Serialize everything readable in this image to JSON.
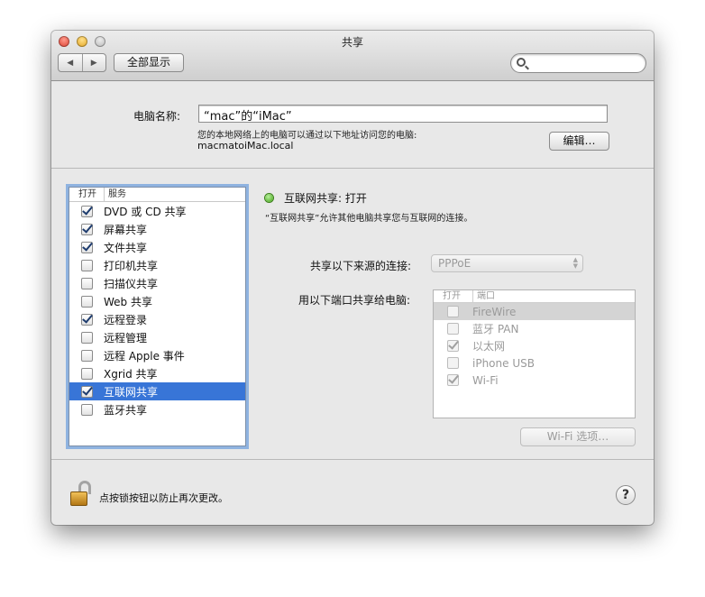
{
  "window": {
    "title": "共享"
  },
  "toolbar": {
    "back_glyph": "◀",
    "forward_glyph": "▶",
    "show_all_label": "全部显示",
    "search_value": ""
  },
  "computer_name": {
    "label": "电脑名称:",
    "value": "“mac”的“iMac”",
    "address_description": "您的本地网络上的电脑可以通过以下地址访问您的电脑:",
    "address": "macmatoiMac.local",
    "edit_label": "编辑…"
  },
  "services": {
    "header_on": "打开",
    "header_service": "服务",
    "items": [
      {
        "label": "DVD 或 CD 共享",
        "checked": true,
        "selected": false
      },
      {
        "label": "屏幕共享",
        "checked": true,
        "selected": false
      },
      {
        "label": "文件共享",
        "checked": true,
        "selected": false
      },
      {
        "label": "打印机共享",
        "checked": false,
        "selected": false
      },
      {
        "label": "扫描仪共享",
        "checked": false,
        "selected": false
      },
      {
        "label": "Web 共享",
        "checked": false,
        "selected": false
      },
      {
        "label": "远程登录",
        "checked": true,
        "selected": false
      },
      {
        "label": "远程管理",
        "checked": false,
        "selected": false
      },
      {
        "label": "远程 Apple 事件",
        "checked": false,
        "selected": false
      },
      {
        "label": "Xgrid 共享",
        "checked": false,
        "selected": false
      },
      {
        "label": "互联网共享",
        "checked": true,
        "selected": true
      },
      {
        "label": "蓝牙共享",
        "checked": false,
        "selected": false
      }
    ]
  },
  "internet_sharing": {
    "status": "互联网共享: 打开",
    "status_color": "#3ea112",
    "description": "“互联网共享”允许其他电脑共享您与互联网的连接。",
    "source_label": "共享以下来源的连接:",
    "source_value": "PPPoE",
    "ports_label": "用以下端口共享给电脑:",
    "ports_header_on": "打开",
    "ports_header_port": "端口",
    "ports": [
      {
        "label": "FireWire",
        "checked": false,
        "selected": true
      },
      {
        "label": "蓝牙 PAN",
        "checked": false,
        "selected": false
      },
      {
        "label": "以太网",
        "checked": true,
        "selected": false
      },
      {
        "label": "iPhone USB",
        "checked": false,
        "selected": false
      },
      {
        "label": "Wi-Fi",
        "checked": true,
        "selected": false
      }
    ],
    "wifi_options_label": "Wi-Fi 选项…"
  },
  "footer": {
    "lock_text": "点按锁按钮以防止再次更改。",
    "help_label": "?"
  },
  "colors": {
    "selection": "#3875d7",
    "focus_ring": "#8fb3e0"
  }
}
